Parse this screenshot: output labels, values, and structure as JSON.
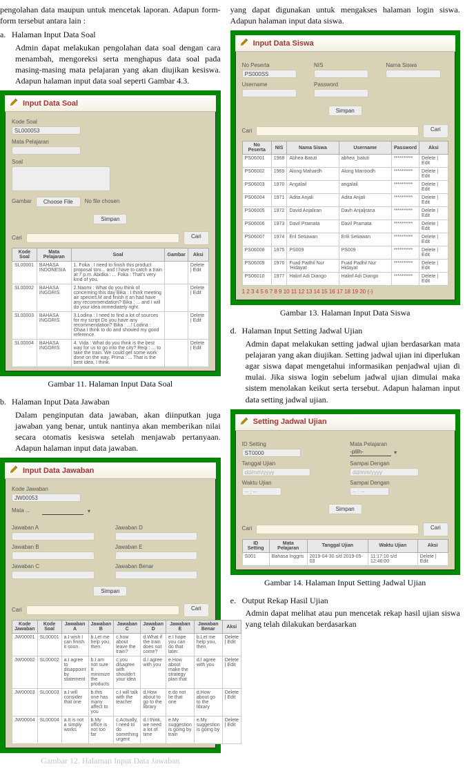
{
  "left": {
    "intro1": "pengolahan data maupun untuk mencetak laporan. Adapun form-form tersebut antara lain :",
    "item_a_letter": "a.",
    "item_a_title": "Halaman Input Data Soal",
    "item_a_body": "Admin dapat melakukan pengolahan data soal dengan cara menambah, mengoreksi serta menghapus data soal pada masing-masing mata pelajaran yang akan diujikan kesiswa. Adapun halaman input data soal seperti Gambar 4.3.",
    "fig11": {
      "title": "Input Data Soal",
      "lbl_kode": "Kode Soal",
      "val_kode": "SL000053",
      "lbl_mapel": "Mata Pelajaran",
      "lbl_soal": "Soal",
      "lbl_gambar": "Gambar",
      "btn_choose": "Choose File",
      "note_choose": "No file chosen",
      "btn_simpan": "Simpan",
      "search_label": "Cari",
      "btn_cari": "Cari",
      "cols": [
        "Kode Soal",
        "Mata Pelajaran",
        "Soal",
        "Gambar",
        "Aksi"
      ],
      "rows": [
        [
          "SL00001",
          "BAHASA INDONESIA",
          "1. Foka : I need to finish this product proposal toni... and I have to catch a train at 7 p.m. Abidka : ... Foka : That's very kind of you.",
          "",
          "Delete | Edit"
        ],
        [
          "SL00002",
          "BAHASA INGGRIS",
          "2.Naomi : What do you think of concerning this day Bika : I think meeting air species.M and finish it an had have any recommendation? Bika : ... and I will do your idea immediately right.",
          "",
          "Delete | Edit"
        ],
        [
          "SL00003",
          "BAHASA INGGRIS",
          "3.Lodina : I need to find a lot of sources for my script Do you have any recommendation? Bika : ...! Lodina : Ohaa I think to do and showed my good reference.",
          "",
          "Delete | Edit"
        ],
        [
          "SL00004",
          "BAHASA INGGRIS",
          "4. Vida : What do you think is the best way for us to go into the city? Reqi : ... to take the train. We could get some work done on the way. Prima : ... That is the best idea, I think.",
          "",
          "Delete | Edit"
        ]
      ],
      "caption": "Gambar 11. Halaman Input Data Soal"
    },
    "item_b_letter": "b.",
    "item_b_title": "Halaman Input Data Jawaban",
    "item_b_body": "Dalam penginputan data jawaban, akan diinputkan juga jawaban yang benar, untuk nantinya akan memberikan nilai secara otomatis kesiswa setelah menjawab pertanyaan. Adapun halaman input data jawaban.",
    "fig12": {
      "title": "Input Data Jawaban",
      "lbl_kode": "Kode Jawaban",
      "val_kode": "JW00053",
      "lbl_mapel": "Mata ...",
      "lbl_a": "Jawaban A",
      "lbl_b": "Jawaban B",
      "lbl_c": "Jawaban C",
      "lbl_d": "Jawaban D",
      "lbl_e": "Jawaban E",
      "lbl_benar": "Jawaban Benar",
      "btn_simpan": "Simpan",
      "search_label": "Cari",
      "btn_cari": "Cari",
      "cols": [
        "Kode Jawaban",
        "Kode Soal",
        "Jawaban A",
        "Jawaban B",
        "Jawaban C",
        "Jawaban D",
        "Jawaban E",
        "Jawaban Benar",
        "Aksi"
      ],
      "rows": [
        [
          "JW00001",
          "SL00001",
          "a.I wish I can finish it soon.",
          "b.Let me help you, then.",
          "c.how about leave the train?",
          "d.What if the train does not come?",
          "e.I hope you can do that later.",
          "b.Let me help you, then.",
          "Delete | Edit"
        ],
        [
          "JW00002",
          "SL00002",
          "a.I agree to disappoint by statement",
          "b.I am not sure It minimize the products",
          "c.you disagree with shouldn't your idea",
          "d.I agree with you",
          "e.How about make the strategy plan that",
          "d.I agree with you",
          "Delete | Edit"
        ],
        [
          "JW00003",
          "SL00003",
          "a.I will consider that one",
          "b.this one has many affect to you",
          "c.I will talk with the teacher",
          "d.How about to go to the library",
          "e.do not lie that one",
          "d.How about go to the library",
          "Delete | Edit"
        ],
        [
          "JW00004",
          "SL00004",
          "a.It is not a simply works",
          "b.My office is not too far",
          "c.Actually, I need to do something urgent",
          "d.I think, we need a lot of time",
          "e.My suggestion is going by train",
          "e.My suggestion is going by",
          "Delete | Edit"
        ]
      ],
      "caption": "Gambar 12. Halaman Input Data Jawaban"
    }
  },
  "right": {
    "intro": "yang dapat digunakan untuk mengakses halaman login siswa. Adapun halaman input data siswa.",
    "fig13": {
      "title": "Input Data Siswa",
      "lbl_nopeserta": "No Peserta",
      "lbl_nis": "NIS",
      "lbl_nama": "Nama Siswa",
      "val_nopeserta": "PS000SS",
      "lbl_username": "Username",
      "lbl_password": "Password",
      "btn_simpan": "Simpan",
      "search_label": "Cari",
      "btn_cari": "Cari",
      "cols": [
        "No Peserta",
        "NIS",
        "Nama Siswa",
        "Username",
        "Password",
        "Aksi"
      ],
      "rows": [
        [
          "PS06001",
          "1968",
          "Abhea Batuti",
          "abhea_batuti",
          "**********",
          "Delete | Edit"
        ],
        [
          "PS06002",
          "1969",
          "Along Mahardh",
          "Along Marmodh",
          "**********",
          "Delete | Edit"
        ],
        [
          "PS06003",
          "1970",
          "Angalail",
          "angalail",
          "**********",
          "Delete | Edit"
        ],
        [
          "PS06004",
          "1971",
          "Adita Anjali",
          "Adita Anjali",
          "**********",
          "Delete | Edit"
        ],
        [
          "PS06005",
          "1972",
          "David Anjaliran",
          "Davh Anjaljrana",
          "**********",
          "Delete | Edit"
        ],
        [
          "PS06006",
          "1973",
          "Davil Pramata",
          "Davil Pramata",
          "**********",
          "Delete | Edit"
        ],
        [
          "PS06007",
          "1974",
          "Eril Setiawan",
          "Erili Setiawan",
          "**********",
          "Delete | Edit"
        ],
        [
          "PS06008",
          "1975",
          "PS009",
          "PS009",
          "**********",
          "Delete | Edit"
        ],
        [
          "PS06009",
          "1976",
          "Fuad Padhil Nur 'Hidayat",
          "Fuad Padhil Nur Hidayat",
          "**********",
          "Delete | Edit"
        ],
        [
          "PS06010",
          "1977",
          "Halinf Adi Diango",
          "Halinf Adi Diango",
          "**********",
          "Delete | Edit"
        ]
      ],
      "pager": "1 2 3 4 5 6 7 8 9 10 11 12 13 14 15 16 17 18 19 20 (-)",
      "caption": "Gambar 13. Halaman Input Data Siswa"
    },
    "item_d_letter": "d.",
    "item_d_title": "Halaman Input Setting Jadwal Ujian",
    "item_d_body": "Admin dapat melakukan setting jadwal ujian berdasarkan mata pelajaran yang akan diujikan. Setting jadwal ujian ini diperlukan agar siswa dapat mengetahui informasikan penjadwal ujian di mulai. Jika siswa login sebelum jadwal ujian dimulai maka sistem menolakan keikut serta tersebut. Adapun halaman input data setting jadwal ujian.",
    "fig14": {
      "title": "Setting Jadwal Ujian",
      "lbl_id": "ID Setting",
      "val_id": "ST0000",
      "lbl_mapel": "Mata Pelajaran",
      "val_mapel": "-pilih-",
      "lbl_tgl": "Tanggal Ujian",
      "ph_date": "dd/mm/yyyy",
      "lbl_sd": "Sampai Dengan",
      "lbl_waktu": "Waktu Ujian",
      "ph_time": "-- : --",
      "btn_simpan": "Simpan",
      "search_label": "Cari",
      "btn_cari": "Cari",
      "cols": [
        "ID Setting",
        "Mata Pelajaran",
        "Tanggal Ujian",
        "Waktu Ujian",
        "Aksi"
      ],
      "rows": [
        [
          "S001",
          "Bahasa Inggris",
          "2019-04-30 s/d 2019-05-03",
          "11:17:10 s/d 12:46:00",
          "Delete | Edit"
        ]
      ],
      "caption": "Gambar 14. Halaman Input Setting Jadwal Ujian"
    },
    "item_e_letter": "e.",
    "item_e_title": "Output Rekap Hasil Ujian",
    "item_e_body": "Admin dapat melihat atau pun mencetak rekap hasil ujian siswa yang telah dilakukan berdasarkan"
  }
}
